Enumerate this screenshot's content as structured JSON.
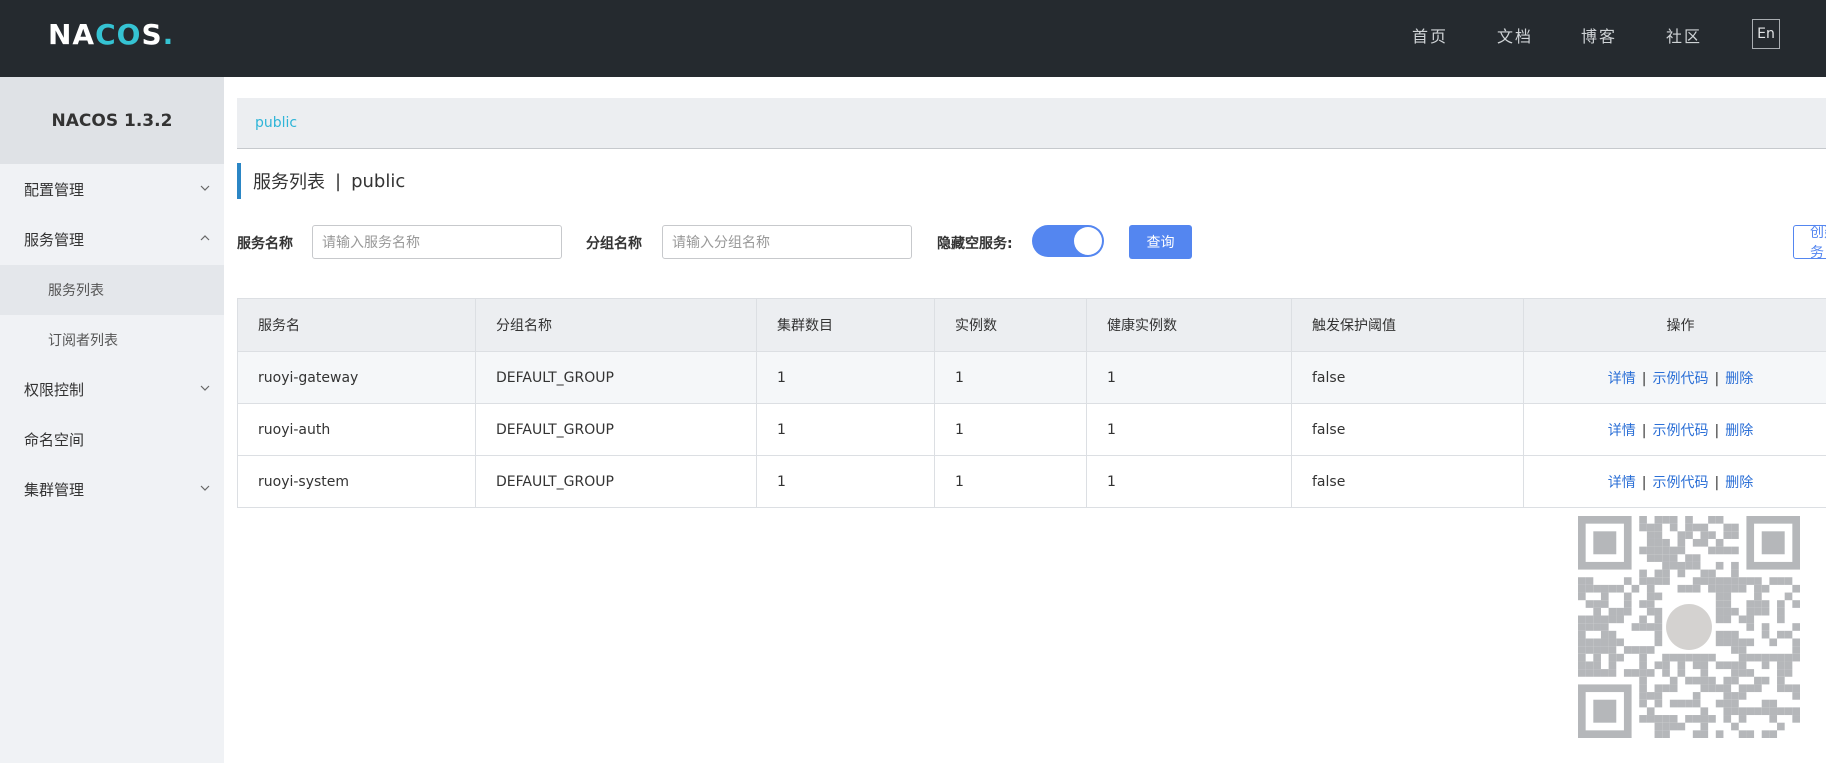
{
  "header": {
    "logo": "NACOS.",
    "nav": [
      "首页",
      "文档",
      "博客",
      "社区"
    ],
    "lang": "En"
  },
  "sidebar": {
    "version": "NACOS 1.3.2",
    "items": [
      {
        "label": "配置管理",
        "expanded": false
      },
      {
        "label": "服务管理",
        "expanded": true
      },
      {
        "label": "服务列表",
        "sub": true,
        "active": true
      },
      {
        "label": "订阅者列表",
        "sub": true
      },
      {
        "label": "权限控制",
        "expanded": false
      },
      {
        "label": "命名空间"
      },
      {
        "label": "集群管理",
        "expanded": false
      }
    ]
  },
  "breadcrumb": {
    "namespace": "public"
  },
  "page": {
    "title": "服务列表",
    "separator": "|",
    "namespace": "public"
  },
  "filters": {
    "service_label": "服务名称",
    "service_placeholder": "请输入服务名称",
    "group_label": "分组名称",
    "group_placeholder": "请输入分组名称",
    "hide_empty_label": "隐藏空服务:",
    "hide_empty_on": true,
    "query_button": "查询",
    "create_button": "创建服务"
  },
  "table": {
    "columns": [
      "服务名",
      "分组名称",
      "集群数目",
      "实例数",
      "健康实例数",
      "触发保护阈值",
      "操作"
    ],
    "rows": [
      {
        "name": "ruoyi-gateway",
        "group": "DEFAULT_GROUP",
        "clusters": "1",
        "instances": "1",
        "healthy": "1",
        "threshold": "false"
      },
      {
        "name": "ruoyi-auth",
        "group": "DEFAULT_GROUP",
        "clusters": "1",
        "instances": "1",
        "healthy": "1",
        "threshold": "false"
      },
      {
        "name": "ruoyi-system",
        "group": "DEFAULT_GROUP",
        "clusters": "1",
        "instances": "1",
        "healthy": "1",
        "threshold": "false"
      }
    ],
    "actions": {
      "detail": "详情",
      "sample": "示例代码",
      "delete": "删除",
      "sep": "|"
    }
  },
  "colors": {
    "header_bg": "#252a2f",
    "accent": "#5486f0",
    "link": "#2b6fd6",
    "breadcrumb": "#2fb5d8"
  }
}
